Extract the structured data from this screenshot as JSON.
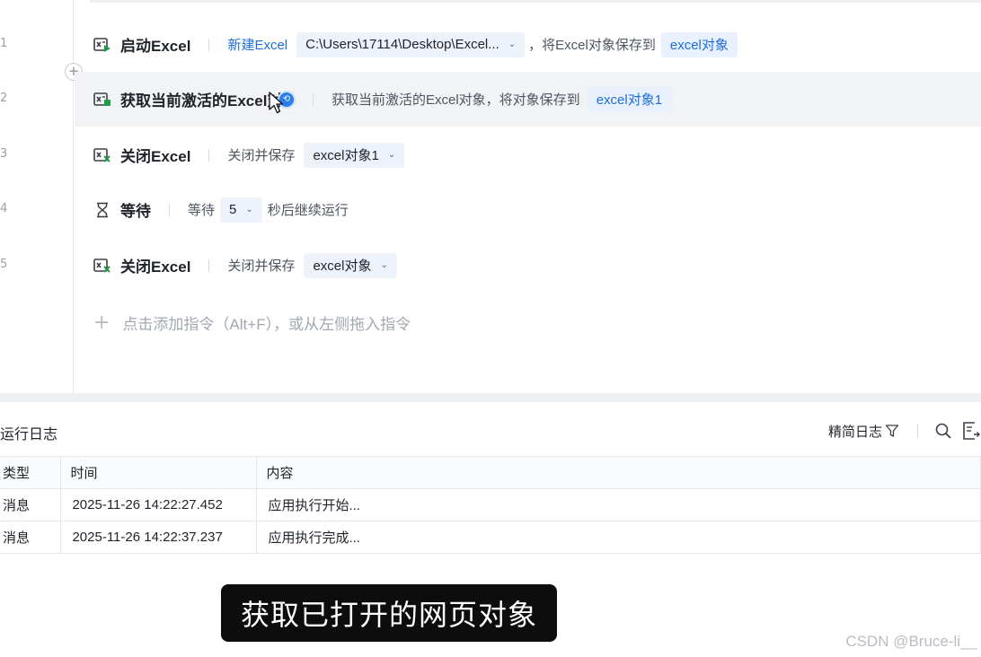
{
  "editor": {
    "line_numbers": [
      "1",
      "2",
      "3",
      "4",
      "5"
    ],
    "rows": [
      {
        "icon": "excel-launch-icon",
        "name": "启动Excel",
        "link": "新建Excel",
        "path": "C:\\Users\\17114\\Desktop\\Excel...",
        "middle": "，将Excel对象保存到",
        "var": "excel对象"
      },
      {
        "icon": "excel-get-active-icon",
        "name": "获取当前激活的Excel对象",
        "desc": "获取当前激活的Excel对象，将对象保存到",
        "var": "excel对象1"
      },
      {
        "icon": "excel-close-icon",
        "name": "关闭Excel",
        "label": "关闭并保存",
        "select": "excel对象1"
      },
      {
        "icon": "hourglass-icon",
        "name": "等待",
        "label": "等待",
        "select": "5",
        "suffix": "秒后继续运行"
      },
      {
        "icon": "excel-close-icon",
        "name": "关闭Excel",
        "label": "关闭并保存",
        "select": "excel对象"
      }
    ],
    "add_hint": "点击添加指令（Alt+F），或从左侧拖入指令"
  },
  "log": {
    "title": "运行日志",
    "filter_label": "精简日志",
    "columns": [
      "类型",
      "时间",
      "内容"
    ],
    "rows": [
      {
        "type": "消息",
        "time": "2025-11-26 14:22:27.452",
        "content": "应用执行开始..."
      },
      {
        "type": "消息",
        "time": "2025-11-26 14:22:37.237",
        "content": "应用执行完成..."
      }
    ]
  },
  "subtitle": "获取已打开的网页对象",
  "watermark": "CSDN @Bruce-li__",
  "colors": {
    "accent": "#1e6fd9",
    "chip_bg": "#eef3fb",
    "active_row_bg": "#f2f3f5",
    "excel_green": "#1e9e4a",
    "close_red": "#2a8f4a"
  }
}
